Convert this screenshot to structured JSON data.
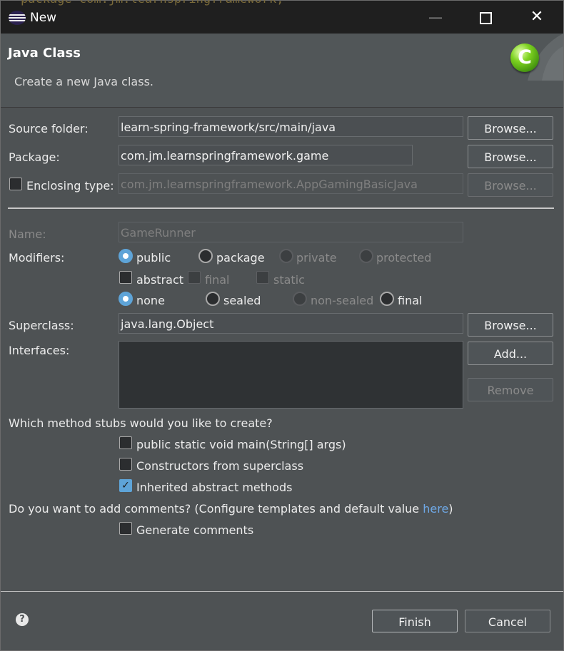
{
  "window": {
    "background_code": "package com.jm.learnspringframework;",
    "title": "New",
    "minimize": "—",
    "close": "✕"
  },
  "header": {
    "title": "Java Class",
    "description": "Create a new Java class.",
    "icon_letter": "C"
  },
  "source_folder": {
    "label": "Source folder:",
    "value": "learn-spring-framework/src/main/java",
    "browse": "Browse..."
  },
  "package": {
    "label": "Package:",
    "value": "com.jm.learnspringframework.game",
    "browse": "Browse..."
  },
  "enclosing_type": {
    "label": "Enclosing type:",
    "value": "com.jm.learnspringframework.AppGamingBasicJava",
    "browse": "Browse...",
    "checked": false
  },
  "name": {
    "label": "Name:",
    "value": "GameRunner"
  },
  "modifiers": {
    "label": "Modifiers:",
    "access": [
      "public",
      "package",
      "private",
      "protected"
    ],
    "flags": [
      "abstract",
      "final",
      "static"
    ],
    "sealing": [
      "none",
      "sealed",
      "non-sealed",
      "final"
    ]
  },
  "superclass": {
    "label": "Superclass:",
    "value": "java.lang.Object",
    "browse": "Browse..."
  },
  "interfaces": {
    "label": "Interfaces:",
    "add": "Add...",
    "remove": "Remove"
  },
  "stubs": {
    "question": "Which method stubs would you like to create?",
    "options": [
      {
        "label": "public static void main(String[] args)",
        "checked": false
      },
      {
        "label": "Constructors from superclass",
        "checked": false
      },
      {
        "label": "Inherited abstract methods",
        "checked": true
      }
    ]
  },
  "comments": {
    "question": "Do you want to add comments? (Configure templates and default value ",
    "link": "here",
    "question_end": ")",
    "option": "Generate comments"
  },
  "footer": {
    "help": "?",
    "finish": "Finish",
    "cancel": "Cancel"
  },
  "colors": {
    "accent": "#5ea4d8",
    "link": "#6ea8e6",
    "dialog_bg": "#4e5254"
  }
}
